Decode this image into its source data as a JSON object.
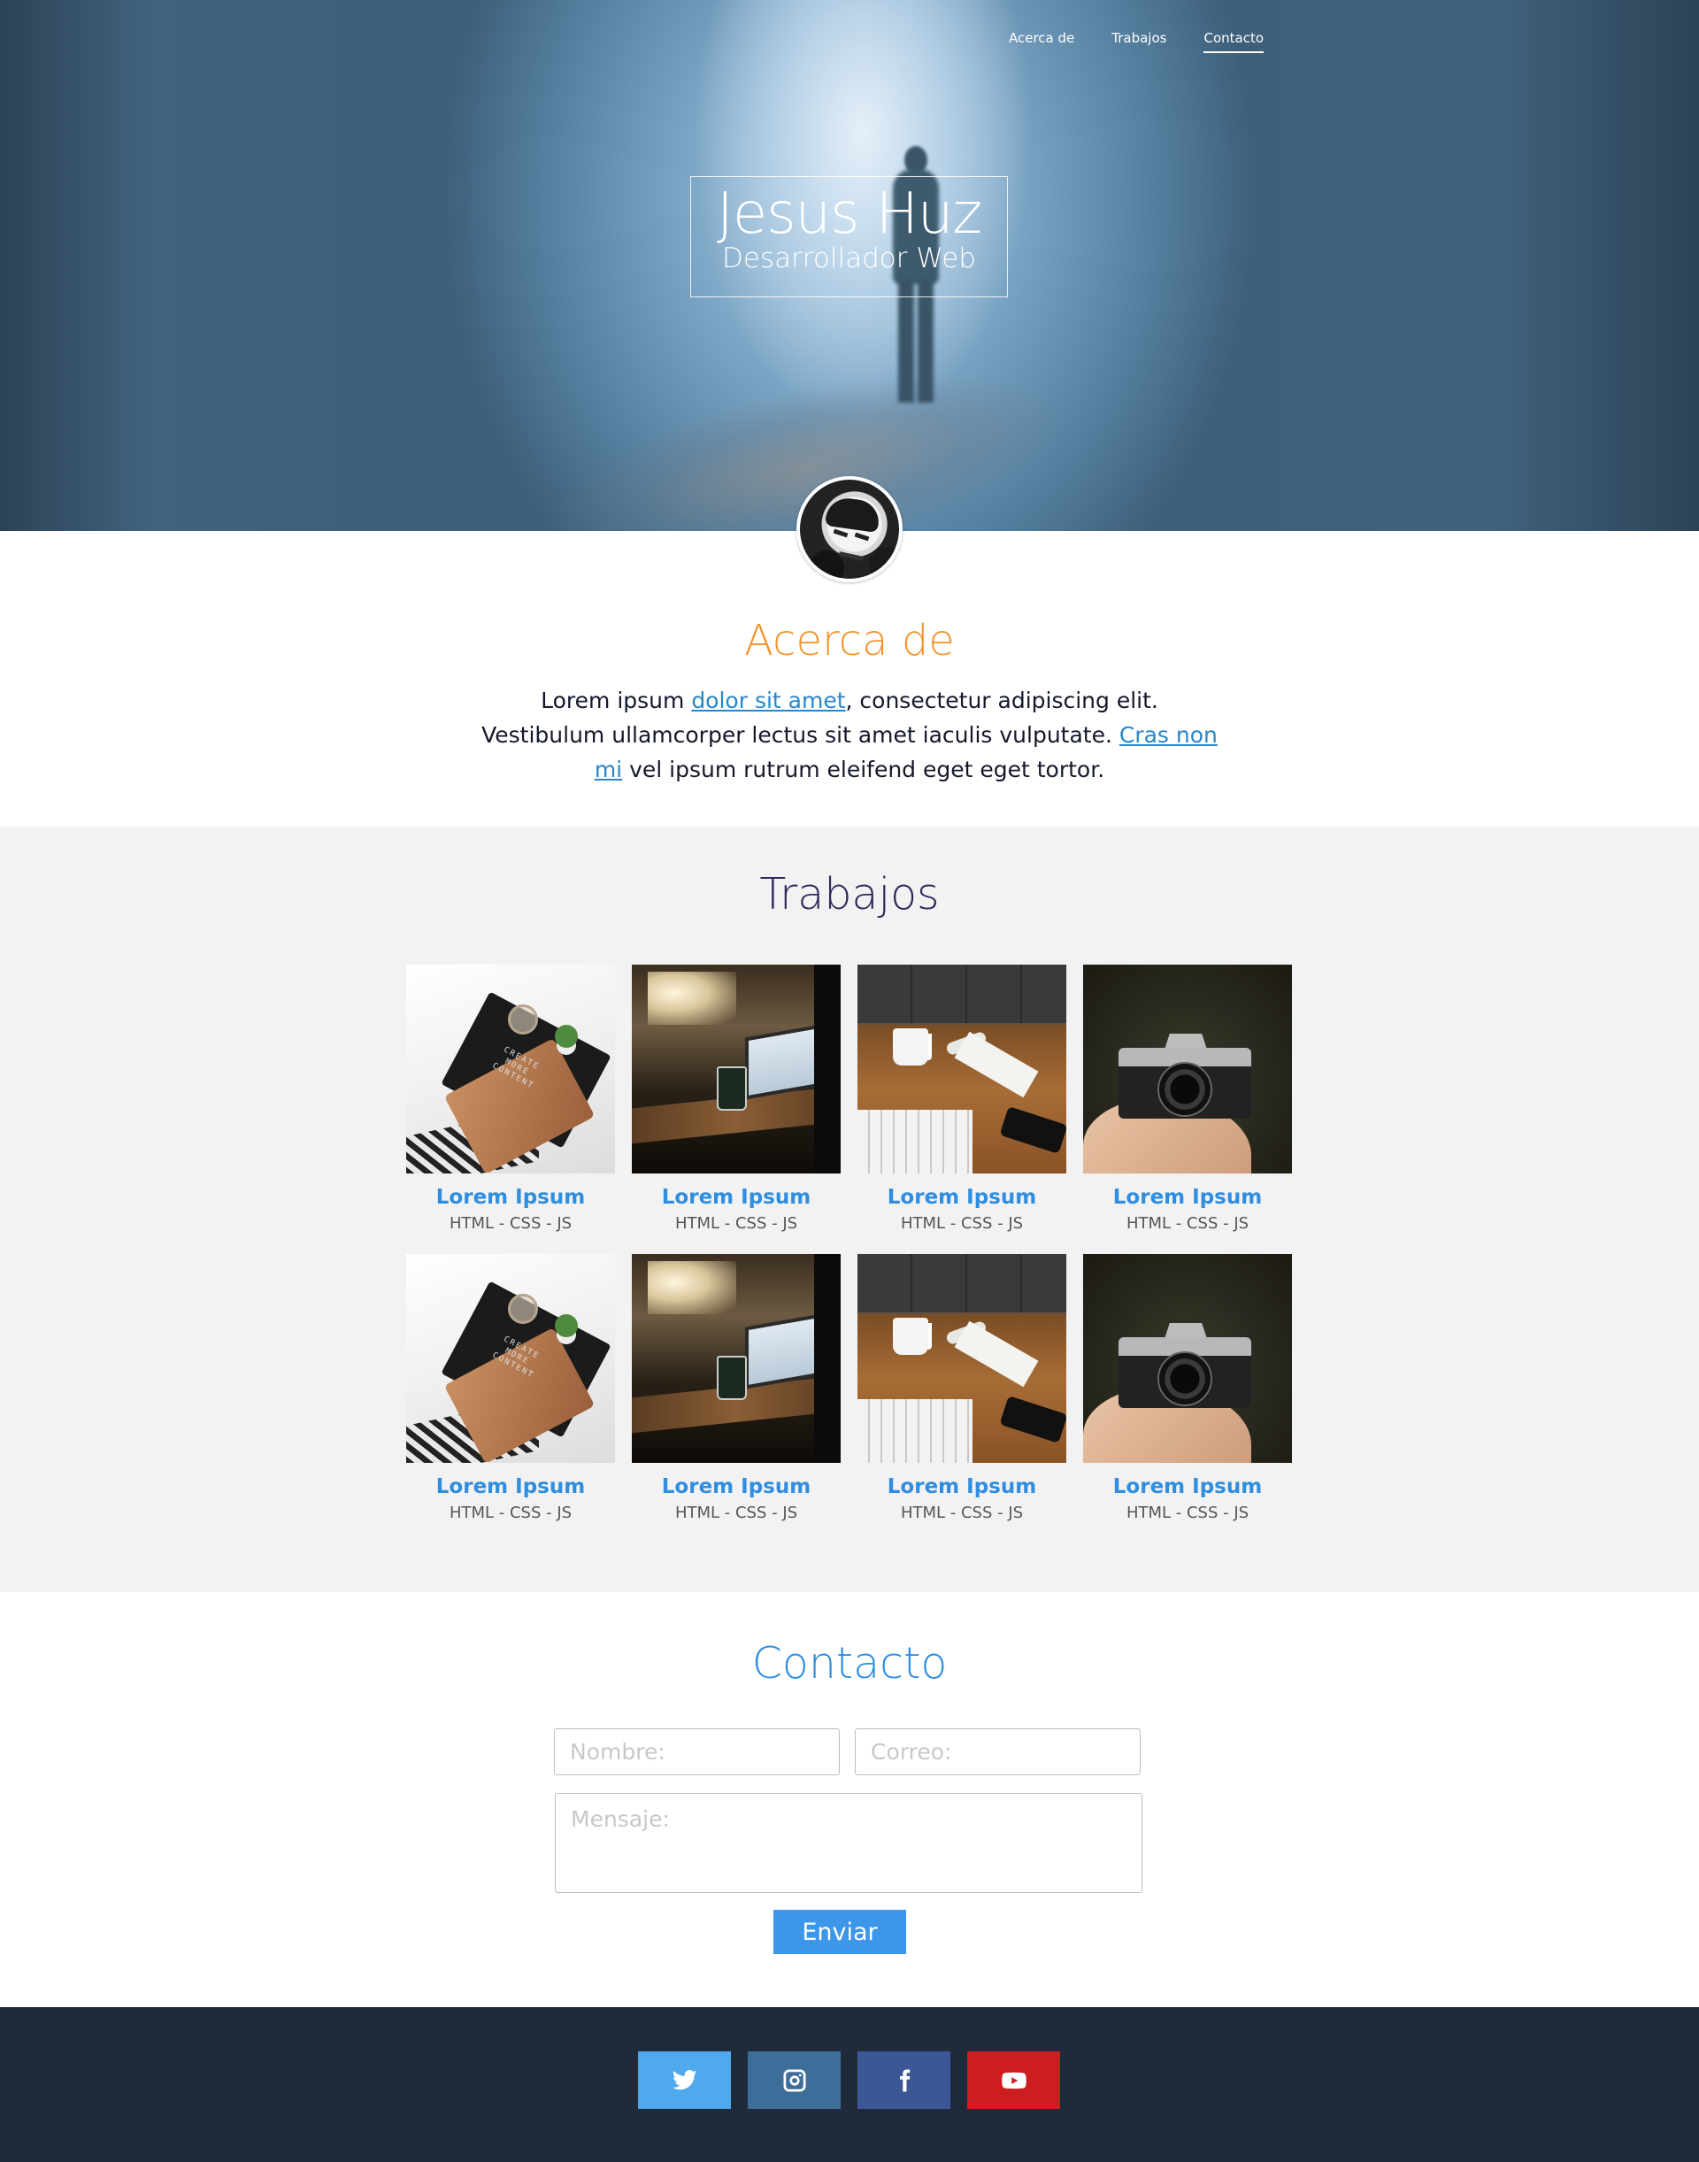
{
  "nav": {
    "items": [
      {
        "label": "Acerca de",
        "active": false
      },
      {
        "label": "Trabajos",
        "active": false
      },
      {
        "label": "Contacto",
        "active": true
      }
    ]
  },
  "hero": {
    "name": "Jesus Huz",
    "role": "Desarrollador Web"
  },
  "about": {
    "title": "Acerca de",
    "text_1": "Lorem ipsum ",
    "link_1": "dolor sit amet",
    "text_2": ", consectetur adipiscing elit. Vestibulum ullamcorper lectus sit amet iaculis vulputate. ",
    "link_2": "Cras non mi",
    "text_3": " vel ipsum rutrum eleifend eget eget tortor."
  },
  "works": {
    "title": "Trabajos",
    "items": [
      {
        "title": "Lorem Ipsum",
        "tech": "HTML - CSS - JS",
        "image": "desk-photo"
      },
      {
        "title": "Lorem Ipsum",
        "tech": "HTML - CSS - JS",
        "image": "cafe-laptop-photo"
      },
      {
        "title": "Lorem Ipsum",
        "tech": "HTML - CSS - JS",
        "image": "wood-desk-photo"
      },
      {
        "title": "Lorem Ipsum",
        "tech": "HTML - CSS - JS",
        "image": "camera-photo"
      },
      {
        "title": "Lorem Ipsum",
        "tech": "HTML - CSS - JS",
        "image": "desk-photo"
      },
      {
        "title": "Lorem Ipsum",
        "tech": "HTML - CSS - JS",
        "image": "cafe-laptop-photo"
      },
      {
        "title": "Lorem Ipsum",
        "tech": "HTML - CSS - JS",
        "image": "wood-desk-photo"
      },
      {
        "title": "Lorem Ipsum",
        "tech": "HTML - CSS - JS",
        "image": "camera-photo"
      }
    ]
  },
  "contact": {
    "title": "Contacto",
    "name_placeholder": "Nombre:",
    "name_value": "",
    "email_placeholder": "Correo:",
    "email_value": "",
    "message_placeholder": "Mensaje:",
    "message_value": "",
    "submit_label": "Enviar"
  },
  "footer": {
    "social": [
      {
        "icon": "twitter-icon",
        "color": "#4fa9ec"
      },
      {
        "icon": "instagram-icon",
        "color": "#3d6e9a"
      },
      {
        "icon": "facebook-icon",
        "color": "#3c5796"
      },
      {
        "icon": "youtube-icon",
        "color": "#cc1d20"
      }
    ]
  },
  "colors": {
    "accent_orange": "#f4962f",
    "accent_blue": "#2f8ee0",
    "works_title": "#2b2a5a",
    "footer_bg": "#1f2a3b",
    "button_blue": "#3c96ea"
  }
}
